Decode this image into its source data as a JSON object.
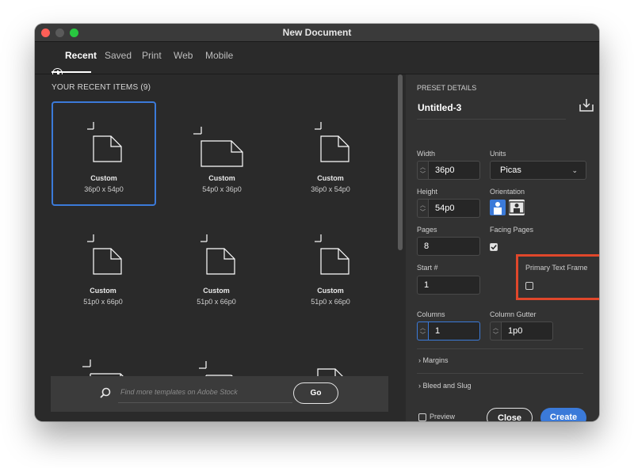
{
  "window": {
    "title": "New Document"
  },
  "tabs": [
    {
      "label": "Recent",
      "active": true
    },
    {
      "label": "Saved"
    },
    {
      "label": "Print"
    },
    {
      "label": "Web"
    },
    {
      "label": "Mobile"
    }
  ],
  "recent": {
    "title": "YOUR RECENT ITEMS (9)",
    "items": [
      {
        "name": "Custom",
        "size": "36p0 x 54p0",
        "orientation": "portrait",
        "selected": true
      },
      {
        "name": "Custom",
        "size": "54p0 x 36p0",
        "orientation": "landscape"
      },
      {
        "name": "Custom",
        "size": "36p0 x 54p0",
        "orientation": "portrait"
      },
      {
        "name": "Custom",
        "size": "51p0 x 66p0",
        "orientation": "portrait"
      },
      {
        "name": "Custom",
        "size": "51p0 x 66p0",
        "orientation": "portrait"
      },
      {
        "name": "Custom",
        "size": "51p0 x 66p0",
        "orientation": "portrait"
      }
    ]
  },
  "search": {
    "placeholder": "Find more templates on Adobe Stock",
    "go_label": "Go"
  },
  "preset": {
    "header": "PRESET DETAILS",
    "name": "Untitled-3",
    "width_label": "Width",
    "width": "36p0",
    "units_label": "Units",
    "units": "Picas",
    "height_label": "Height",
    "height": "54p0",
    "orientation_label": "Orientation",
    "orientation": "portrait",
    "pages_label": "Pages",
    "pages": "8",
    "facing_label": "Facing Pages",
    "facing_checked": true,
    "start_label": "Start #",
    "start": "1",
    "primary_label": "Primary Text Frame",
    "primary_checked": false,
    "columns_label": "Columns",
    "columns": "1",
    "gutter_label": "Column Gutter",
    "gutter": "1p0",
    "margins_label": "Margins",
    "bleed_label": "Bleed and Slug",
    "preview_label": "Preview",
    "close_label": "Close",
    "create_label": "Create"
  },
  "colors": {
    "accent": "#3b7ad9",
    "highlight": "#e0472b",
    "panel": "#2a2a2a",
    "right_panel": "#323232"
  }
}
